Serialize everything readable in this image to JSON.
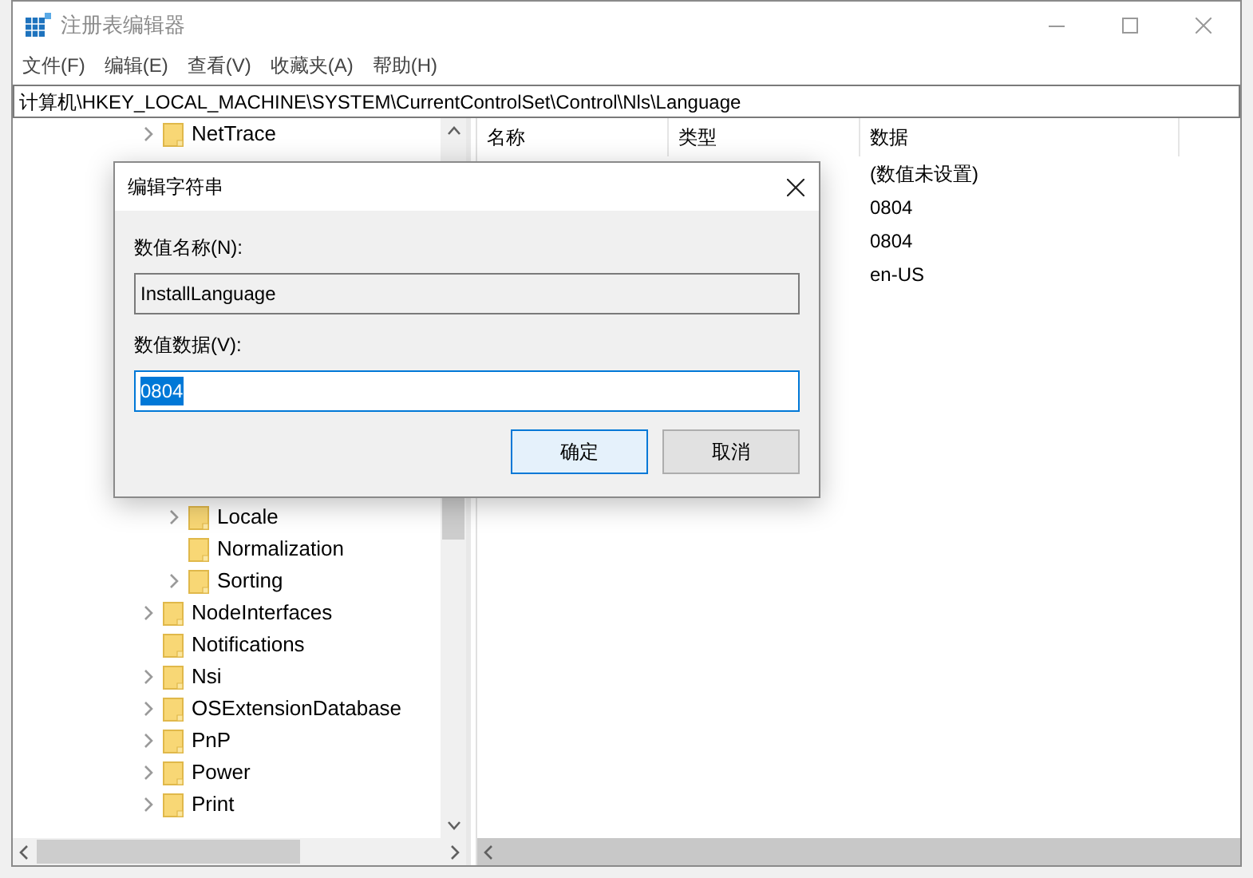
{
  "window": {
    "title": "注册表编辑器"
  },
  "menu": [
    "文件(F)",
    "编辑(E)",
    "查看(V)",
    "收藏夹(A)",
    "帮助(H)"
  ],
  "address": "计算机\\HKEY_LOCAL_MACHINE\\SYSTEM\\CurrentControlSet\\Control\\Nls\\Language",
  "tree": {
    "items": [
      {
        "label": "NetTrace",
        "expandable": true
      },
      {
        "children": [
          {
            "label": "Locale",
            "expandable": true
          },
          {
            "label": "Normalization",
            "expandable": false
          },
          {
            "label": "Sorting",
            "expandable": true
          }
        ]
      },
      {
        "label": "NodeInterfaces",
        "expandable": true
      },
      {
        "label": "Notifications",
        "expandable": false
      },
      {
        "label": "Nsi",
        "expandable": true
      },
      {
        "label": "OSExtensionDatabase",
        "expandable": true
      },
      {
        "label": "PnP",
        "expandable": true
      },
      {
        "label": "Power",
        "expandable": true
      },
      {
        "label": "Print",
        "expandable": true
      }
    ]
  },
  "values": {
    "columns": [
      "名称",
      "类型",
      "数据"
    ],
    "rows": [
      {
        "data": "(数值未设置)"
      },
      {
        "data": "0804"
      },
      {
        "data": "0804"
      },
      {
        "data": "en-US"
      }
    ]
  },
  "dialog": {
    "title": "编辑字符串",
    "name_label": "数值名称(N):",
    "name_value": "InstallLanguage",
    "data_label": "数值数据(V):",
    "data_value": "0804",
    "data_selected": true,
    "buttons": [
      {
        "label": "确定",
        "default": true
      },
      {
        "label": "取消",
        "default": false
      }
    ]
  }
}
